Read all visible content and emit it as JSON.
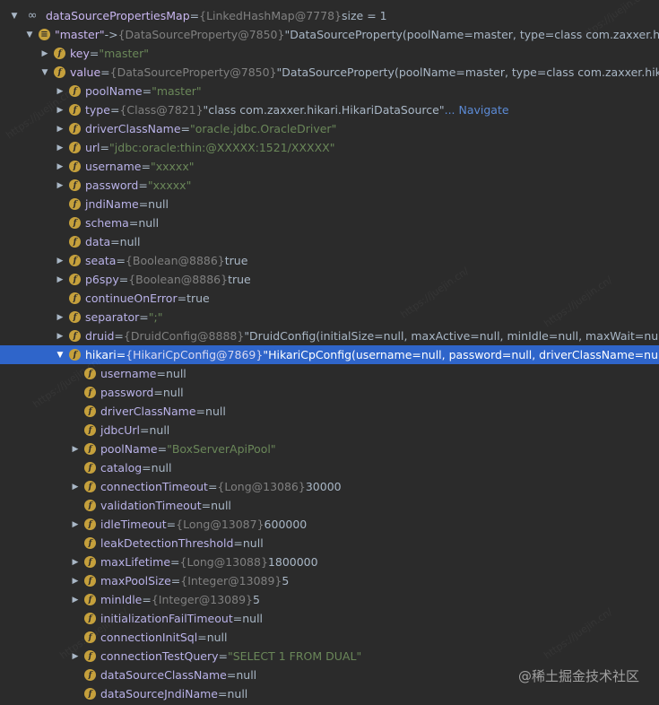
{
  "rows": [
    {
      "indent": 0,
      "arrow": "down",
      "icon": "oo",
      "name": "dataSourcePropertiesMap",
      "eq": " = ",
      "ref": "{LinkedHashMap@7778}",
      "value": "  size = 1"
    },
    {
      "indent": 1,
      "arrow": "down",
      "icon": "eq",
      "name": "\"master\"",
      "eq": " -> ",
      "ref": "{DataSourceProperty@7850}",
      "value": " \"DataSourceProperty(poolName=master, type=class com.zaxxer.hikari.HikariDataSource, driverClassName=oracle.jdbc.OracleDriver"
    },
    {
      "indent": 2,
      "arrow": "right",
      "icon": "f",
      "name": "key",
      "eq": " = ",
      "str": "\"master\""
    },
    {
      "indent": 2,
      "arrow": "down",
      "icon": "f",
      "name": "value",
      "eq": " = ",
      "ref": "{DataSourceProperty@7850}",
      "value": " \"DataSourceProperty(poolName=master, type=class com.zaxxer.hikari.HikariDataSource, driverClassName=oracle.jdbc.OracleDriver"
    },
    {
      "indent": 3,
      "arrow": "right",
      "icon": "f",
      "name": "poolName",
      "eq": " = ",
      "str": "\"master\""
    },
    {
      "indent": 3,
      "arrow": "right",
      "icon": "f",
      "name": "type",
      "eq": " = ",
      "ref": "{Class@7821}",
      "value": " \"class com.zaxxer.hikari.HikariDataSource\"",
      "link": " ... Navigate"
    },
    {
      "indent": 3,
      "arrow": "right",
      "icon": "f",
      "name": "driverClassName",
      "eq": " = ",
      "str": "\"oracle.jdbc.OracleDriver\""
    },
    {
      "indent": 3,
      "arrow": "right",
      "icon": "f",
      "name": "url",
      "eq": " = ",
      "str": "\"jdbc:oracle:thin:@XXXXX:1521/XXXXX\""
    },
    {
      "indent": 3,
      "arrow": "right",
      "icon": "f",
      "name": "username",
      "eq": " = ",
      "str": "\"xxxxx\""
    },
    {
      "indent": 3,
      "arrow": "right",
      "icon": "f",
      "name": "password",
      "eq": " = ",
      "str": "\"xxxxx\""
    },
    {
      "indent": 3,
      "arrow": "none",
      "icon": "f",
      "name": "jndiName",
      "eq": " = ",
      "value": "null"
    },
    {
      "indent": 3,
      "arrow": "none",
      "icon": "f",
      "name": "schema",
      "eq": " = ",
      "value": "null"
    },
    {
      "indent": 3,
      "arrow": "none",
      "icon": "f",
      "name": "data",
      "eq": " = ",
      "value": "null"
    },
    {
      "indent": 3,
      "arrow": "right",
      "icon": "f",
      "name": "seata",
      "eq": " = ",
      "ref": "{Boolean@8886}",
      "value": " true"
    },
    {
      "indent": 3,
      "arrow": "right",
      "icon": "f",
      "name": "p6spy",
      "eq": " = ",
      "ref": "{Boolean@8886}",
      "value": " true"
    },
    {
      "indent": 3,
      "arrow": "none",
      "icon": "f",
      "name": "continueOnError",
      "eq": " = ",
      "value": "true"
    },
    {
      "indent": 3,
      "arrow": "right",
      "icon": "f",
      "name": "separator",
      "eq": " = ",
      "str": "\";\""
    },
    {
      "indent": 3,
      "arrow": "right",
      "icon": "f",
      "name": "druid",
      "eq": " = ",
      "ref": "{DruidConfig@8888}",
      "value": " \"DruidConfig(initialSize=null, maxActive=null, minIdle=null, maxWait=null, timeBetweenEvictionRunsMillis=null"
    },
    {
      "indent": 3,
      "arrow": "down",
      "icon": "f",
      "name": "hikari",
      "eq": " = ",
      "ref": "{HikariCpConfig@7869}",
      "value": " \"HikariCpConfig(username=null, password=null, driverClassName=null, jdbcUrl=null, poolName=BoxServerApiPool",
      "selected": true
    },
    {
      "indent": 4,
      "arrow": "none",
      "icon": "f",
      "name": "username",
      "eq": " = ",
      "value": "null"
    },
    {
      "indent": 4,
      "arrow": "none",
      "icon": "f",
      "name": "password",
      "eq": " = ",
      "value": "null"
    },
    {
      "indent": 4,
      "arrow": "none",
      "icon": "f",
      "name": "driverClassName",
      "eq": " = ",
      "value": "null"
    },
    {
      "indent": 4,
      "arrow": "none",
      "icon": "f",
      "name": "jdbcUrl",
      "eq": " = ",
      "value": "null"
    },
    {
      "indent": 4,
      "arrow": "right",
      "icon": "f",
      "name": "poolName",
      "eq": " = ",
      "str": "\"BoxServerApiPool\""
    },
    {
      "indent": 4,
      "arrow": "none",
      "icon": "f",
      "name": "catalog",
      "eq": " = ",
      "value": "null"
    },
    {
      "indent": 4,
      "arrow": "right",
      "icon": "f",
      "name": "connectionTimeout",
      "eq": " = ",
      "ref": "{Long@13086}",
      "value": " 30000"
    },
    {
      "indent": 4,
      "arrow": "none",
      "icon": "f",
      "name": "validationTimeout",
      "eq": " = ",
      "value": "null"
    },
    {
      "indent": 4,
      "arrow": "right",
      "icon": "f",
      "name": "idleTimeout",
      "eq": " = ",
      "ref": "{Long@13087}",
      "value": " 600000"
    },
    {
      "indent": 4,
      "arrow": "none",
      "icon": "f",
      "name": "leakDetectionThreshold",
      "eq": " = ",
      "value": "null"
    },
    {
      "indent": 4,
      "arrow": "right",
      "icon": "f",
      "name": "maxLifetime",
      "eq": " = ",
      "ref": "{Long@13088}",
      "value": " 1800000"
    },
    {
      "indent": 4,
      "arrow": "right",
      "icon": "f",
      "name": "maxPoolSize",
      "eq": " = ",
      "ref": "{Integer@13089}",
      "value": " 5"
    },
    {
      "indent": 4,
      "arrow": "right",
      "icon": "f",
      "name": "minIdle",
      "eq": " = ",
      "ref": "{Integer@13089}",
      "value": " 5"
    },
    {
      "indent": 4,
      "arrow": "none",
      "icon": "f",
      "name": "initializationFailTimeout",
      "eq": " = ",
      "value": "null"
    },
    {
      "indent": 4,
      "arrow": "none",
      "icon": "f",
      "name": "connectionInitSql",
      "eq": " = ",
      "value": "null"
    },
    {
      "indent": 4,
      "arrow": "right",
      "icon": "f",
      "name": "connectionTestQuery",
      "eq": " = ",
      "str": "\"SELECT 1 FROM DUAL\""
    },
    {
      "indent": 4,
      "arrow": "none",
      "icon": "f",
      "name": "dataSourceClassName",
      "eq": " = ",
      "value": "null"
    },
    {
      "indent": 4,
      "arrow": "none",
      "icon": "f",
      "name": "dataSourceJndiName",
      "eq": " = ",
      "value": "null"
    }
  ],
  "credit": "@稀土掘金技术社区",
  "watermark": "https://juejin.cn/"
}
